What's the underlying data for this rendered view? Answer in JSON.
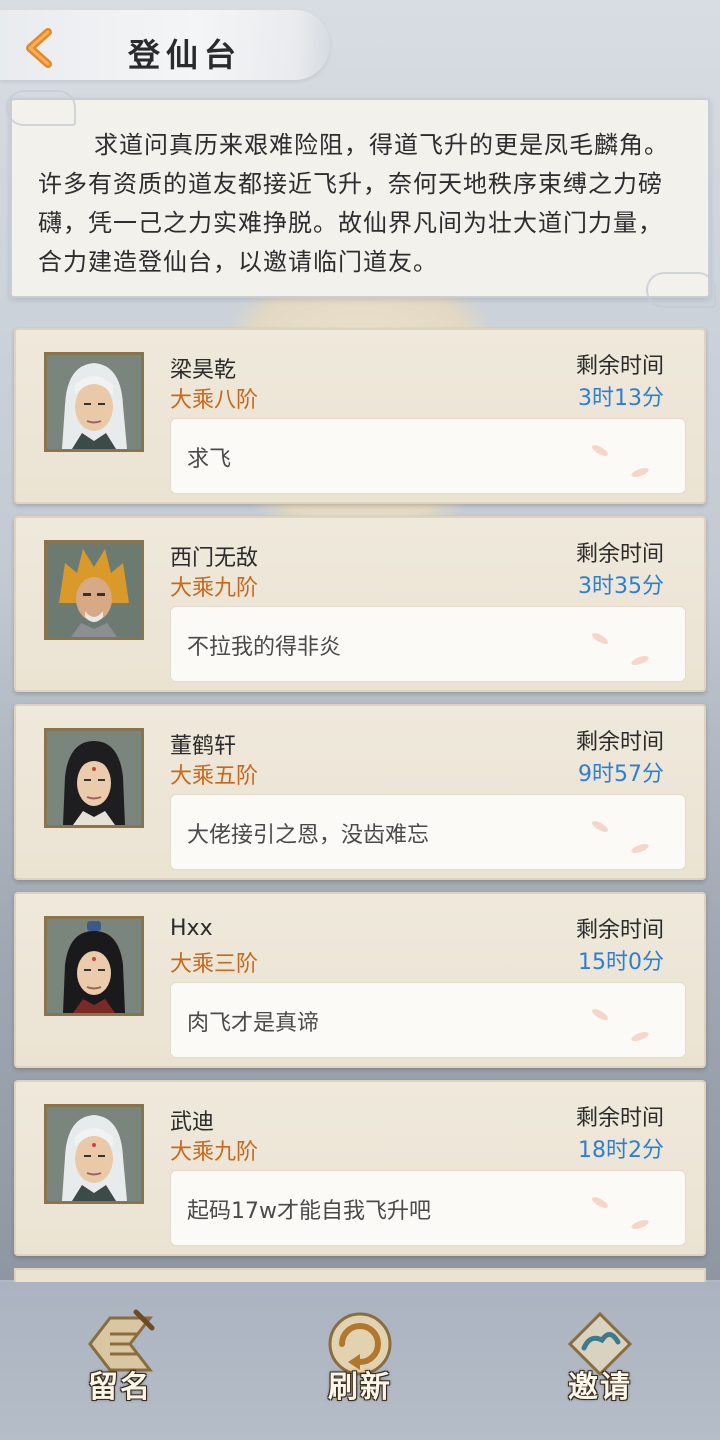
{
  "header": {
    "title": "登仙台",
    "back_icon": "back-arrow-icon"
  },
  "intro": {
    "text": "求道问真历来艰难险阻，得道飞升的更是凤毛麟角。许多有资质的道友都接近飞升，奈何天地秩序束缚之力磅礴，凭一己之力实难挣脱。故仙界凡间为壮大道门力量，合力建造登仙台，以邀请临门道友。"
  },
  "remain_label": "剩余时间",
  "entries": [
    {
      "name": "梁昊乾",
      "rank": "大乘八阶",
      "time": "3时13分",
      "message": "求飞",
      "avatar": "white-hair-avatar"
    },
    {
      "name": "西门无敌",
      "rank": "大乘九阶",
      "time": "3时35分",
      "message": "不拉我的得非炎",
      "avatar": "golden-hair-avatar"
    },
    {
      "name": "董鹤轩",
      "rank": "大乘五阶",
      "time": "9时57分",
      "message": "大佬接引之恩，没齿难忘",
      "avatar": "black-hair-avatar"
    },
    {
      "name": "Hxx",
      "rank": "大乘三阶",
      "time": "15时0分",
      "message": "肉飞才是真谛",
      "avatar": "topknot-avatar"
    },
    {
      "name": "武迪",
      "rank": "大乘九阶",
      "time": "18时2分",
      "message": "起码17w才能自我飞升吧",
      "avatar": "white-hair-avatar"
    }
  ],
  "actions": {
    "leave_name": "留名",
    "refresh": "刷新",
    "invite": "邀请"
  },
  "colors": {
    "rank": "#c8681c",
    "time": "#2d7fd3",
    "card_bg": "#ebe3d2"
  }
}
